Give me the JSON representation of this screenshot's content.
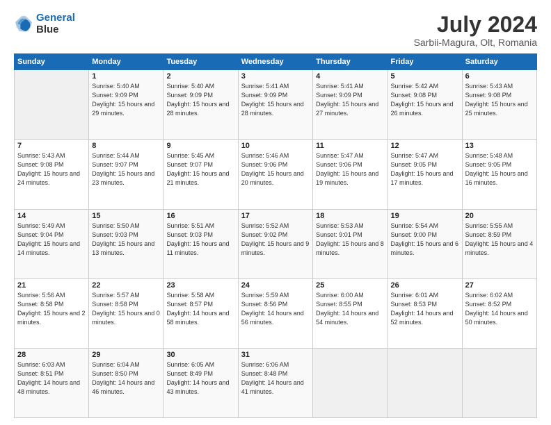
{
  "header": {
    "logo_line1": "General",
    "logo_line2": "Blue",
    "title": "July 2024",
    "subtitle": "Sarbii-Magura, Olt, Romania"
  },
  "weekdays": [
    "Sunday",
    "Monday",
    "Tuesday",
    "Wednesday",
    "Thursday",
    "Friday",
    "Saturday"
  ],
  "weeks": [
    [
      {
        "day": "",
        "sunrise": "",
        "sunset": "",
        "daylight": ""
      },
      {
        "day": "1",
        "sunrise": "Sunrise: 5:40 AM",
        "sunset": "Sunset: 9:09 PM",
        "daylight": "Daylight: 15 hours and 29 minutes."
      },
      {
        "day": "2",
        "sunrise": "Sunrise: 5:40 AM",
        "sunset": "Sunset: 9:09 PM",
        "daylight": "Daylight: 15 hours and 28 minutes."
      },
      {
        "day": "3",
        "sunrise": "Sunrise: 5:41 AM",
        "sunset": "Sunset: 9:09 PM",
        "daylight": "Daylight: 15 hours and 28 minutes."
      },
      {
        "day": "4",
        "sunrise": "Sunrise: 5:41 AM",
        "sunset": "Sunset: 9:09 PM",
        "daylight": "Daylight: 15 hours and 27 minutes."
      },
      {
        "day": "5",
        "sunrise": "Sunrise: 5:42 AM",
        "sunset": "Sunset: 9:08 PM",
        "daylight": "Daylight: 15 hours and 26 minutes."
      },
      {
        "day": "6",
        "sunrise": "Sunrise: 5:43 AM",
        "sunset": "Sunset: 9:08 PM",
        "daylight": "Daylight: 15 hours and 25 minutes."
      }
    ],
    [
      {
        "day": "7",
        "sunrise": "Sunrise: 5:43 AM",
        "sunset": "Sunset: 9:08 PM",
        "daylight": "Daylight: 15 hours and 24 minutes."
      },
      {
        "day": "8",
        "sunrise": "Sunrise: 5:44 AM",
        "sunset": "Sunset: 9:07 PM",
        "daylight": "Daylight: 15 hours and 23 minutes."
      },
      {
        "day": "9",
        "sunrise": "Sunrise: 5:45 AM",
        "sunset": "Sunset: 9:07 PM",
        "daylight": "Daylight: 15 hours and 21 minutes."
      },
      {
        "day": "10",
        "sunrise": "Sunrise: 5:46 AM",
        "sunset": "Sunset: 9:06 PM",
        "daylight": "Daylight: 15 hours and 20 minutes."
      },
      {
        "day": "11",
        "sunrise": "Sunrise: 5:47 AM",
        "sunset": "Sunset: 9:06 PM",
        "daylight": "Daylight: 15 hours and 19 minutes."
      },
      {
        "day": "12",
        "sunrise": "Sunrise: 5:47 AM",
        "sunset": "Sunset: 9:05 PM",
        "daylight": "Daylight: 15 hours and 17 minutes."
      },
      {
        "day": "13",
        "sunrise": "Sunrise: 5:48 AM",
        "sunset": "Sunset: 9:05 PM",
        "daylight": "Daylight: 15 hours and 16 minutes."
      }
    ],
    [
      {
        "day": "14",
        "sunrise": "Sunrise: 5:49 AM",
        "sunset": "Sunset: 9:04 PM",
        "daylight": "Daylight: 15 hours and 14 minutes."
      },
      {
        "day": "15",
        "sunrise": "Sunrise: 5:50 AM",
        "sunset": "Sunset: 9:03 PM",
        "daylight": "Daylight: 15 hours and 13 minutes."
      },
      {
        "day": "16",
        "sunrise": "Sunrise: 5:51 AM",
        "sunset": "Sunset: 9:03 PM",
        "daylight": "Daylight: 15 hours and 11 minutes."
      },
      {
        "day": "17",
        "sunrise": "Sunrise: 5:52 AM",
        "sunset": "Sunset: 9:02 PM",
        "daylight": "Daylight: 15 hours and 9 minutes."
      },
      {
        "day": "18",
        "sunrise": "Sunrise: 5:53 AM",
        "sunset": "Sunset: 9:01 PM",
        "daylight": "Daylight: 15 hours and 8 minutes."
      },
      {
        "day": "19",
        "sunrise": "Sunrise: 5:54 AM",
        "sunset": "Sunset: 9:00 PM",
        "daylight": "Daylight: 15 hours and 6 minutes."
      },
      {
        "day": "20",
        "sunrise": "Sunrise: 5:55 AM",
        "sunset": "Sunset: 8:59 PM",
        "daylight": "Daylight: 15 hours and 4 minutes."
      }
    ],
    [
      {
        "day": "21",
        "sunrise": "Sunrise: 5:56 AM",
        "sunset": "Sunset: 8:58 PM",
        "daylight": "Daylight: 15 hours and 2 minutes."
      },
      {
        "day": "22",
        "sunrise": "Sunrise: 5:57 AM",
        "sunset": "Sunset: 8:58 PM",
        "daylight": "Daylight: 15 hours and 0 minutes."
      },
      {
        "day": "23",
        "sunrise": "Sunrise: 5:58 AM",
        "sunset": "Sunset: 8:57 PM",
        "daylight": "Daylight: 14 hours and 58 minutes."
      },
      {
        "day": "24",
        "sunrise": "Sunrise: 5:59 AM",
        "sunset": "Sunset: 8:56 PM",
        "daylight": "Daylight: 14 hours and 56 minutes."
      },
      {
        "day": "25",
        "sunrise": "Sunrise: 6:00 AM",
        "sunset": "Sunset: 8:55 PM",
        "daylight": "Daylight: 14 hours and 54 minutes."
      },
      {
        "day": "26",
        "sunrise": "Sunrise: 6:01 AM",
        "sunset": "Sunset: 8:53 PM",
        "daylight": "Daylight: 14 hours and 52 minutes."
      },
      {
        "day": "27",
        "sunrise": "Sunrise: 6:02 AM",
        "sunset": "Sunset: 8:52 PM",
        "daylight": "Daylight: 14 hours and 50 minutes."
      }
    ],
    [
      {
        "day": "28",
        "sunrise": "Sunrise: 6:03 AM",
        "sunset": "Sunset: 8:51 PM",
        "daylight": "Daylight: 14 hours and 48 minutes."
      },
      {
        "day": "29",
        "sunrise": "Sunrise: 6:04 AM",
        "sunset": "Sunset: 8:50 PM",
        "daylight": "Daylight: 14 hours and 46 minutes."
      },
      {
        "day": "30",
        "sunrise": "Sunrise: 6:05 AM",
        "sunset": "Sunset: 8:49 PM",
        "daylight": "Daylight: 14 hours and 43 minutes."
      },
      {
        "day": "31",
        "sunrise": "Sunrise: 6:06 AM",
        "sunset": "Sunset: 8:48 PM",
        "daylight": "Daylight: 14 hours and 41 minutes."
      },
      {
        "day": "",
        "sunrise": "",
        "sunset": "",
        "daylight": ""
      },
      {
        "day": "",
        "sunrise": "",
        "sunset": "",
        "daylight": ""
      },
      {
        "day": "",
        "sunrise": "",
        "sunset": "",
        "daylight": ""
      }
    ]
  ]
}
